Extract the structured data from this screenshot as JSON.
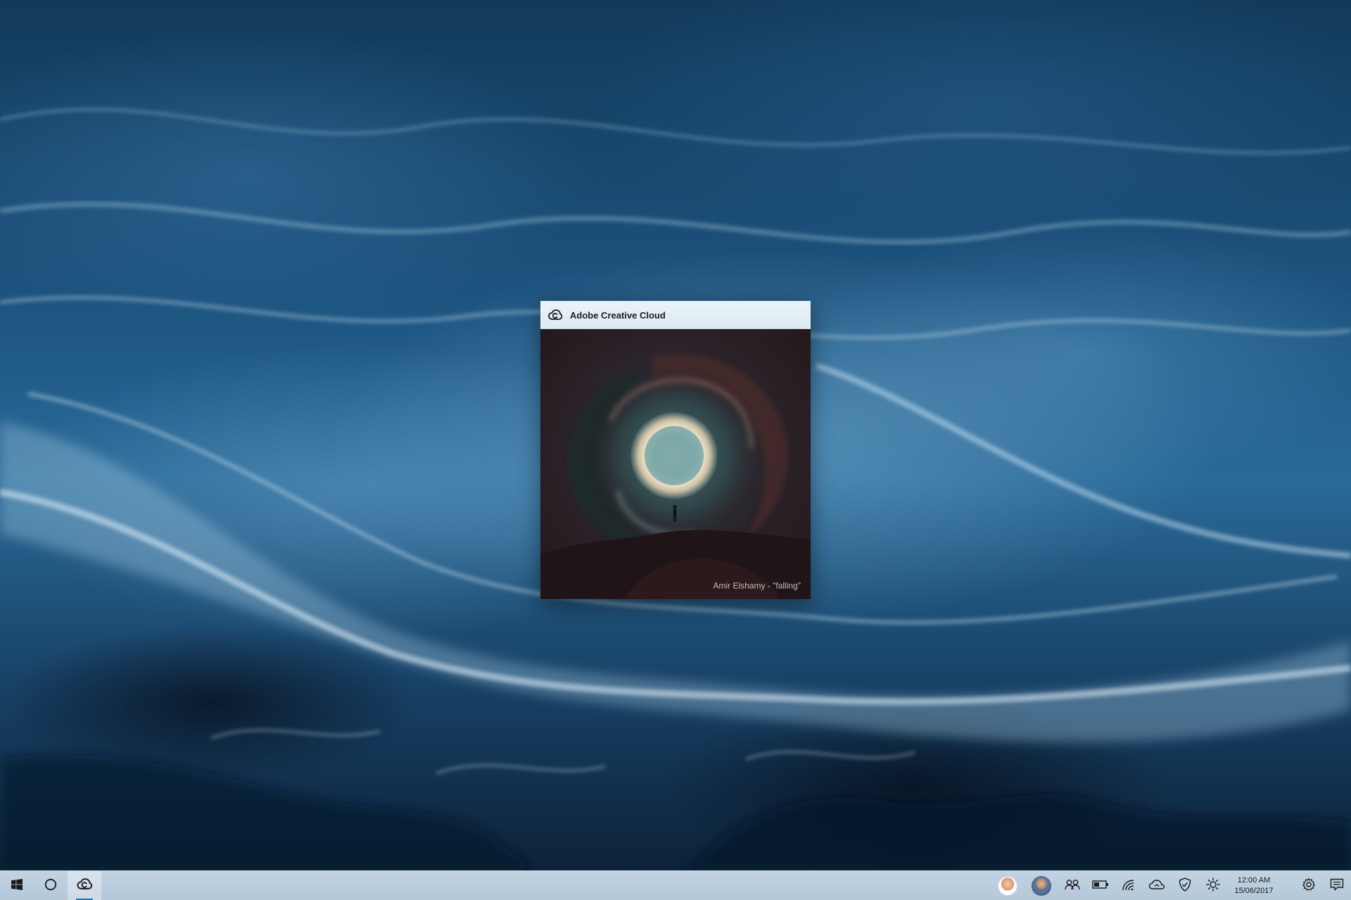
{
  "widget": {
    "title": "Adobe Creative Cloud",
    "credit": "Amir Elshamy - \"falling\""
  },
  "taskbar": {
    "start": "windows-logo-icon",
    "cortana": "cortana-circle-icon",
    "pinned": [
      "creative-cloud-icon"
    ]
  },
  "tray": {
    "icons": [
      "people-icon",
      "battery-icon",
      "wifi-icon",
      "cloud-icon",
      "shield-icon",
      "brightness-icon",
      "settings-icon",
      "action-center-icon"
    ],
    "time": "12:00 AM",
    "date": "15/06/2017"
  },
  "colors": {
    "accent": "#1a73b8",
    "taskbar": "#c3d6e6",
    "titlebar": "#e4eef6"
  }
}
